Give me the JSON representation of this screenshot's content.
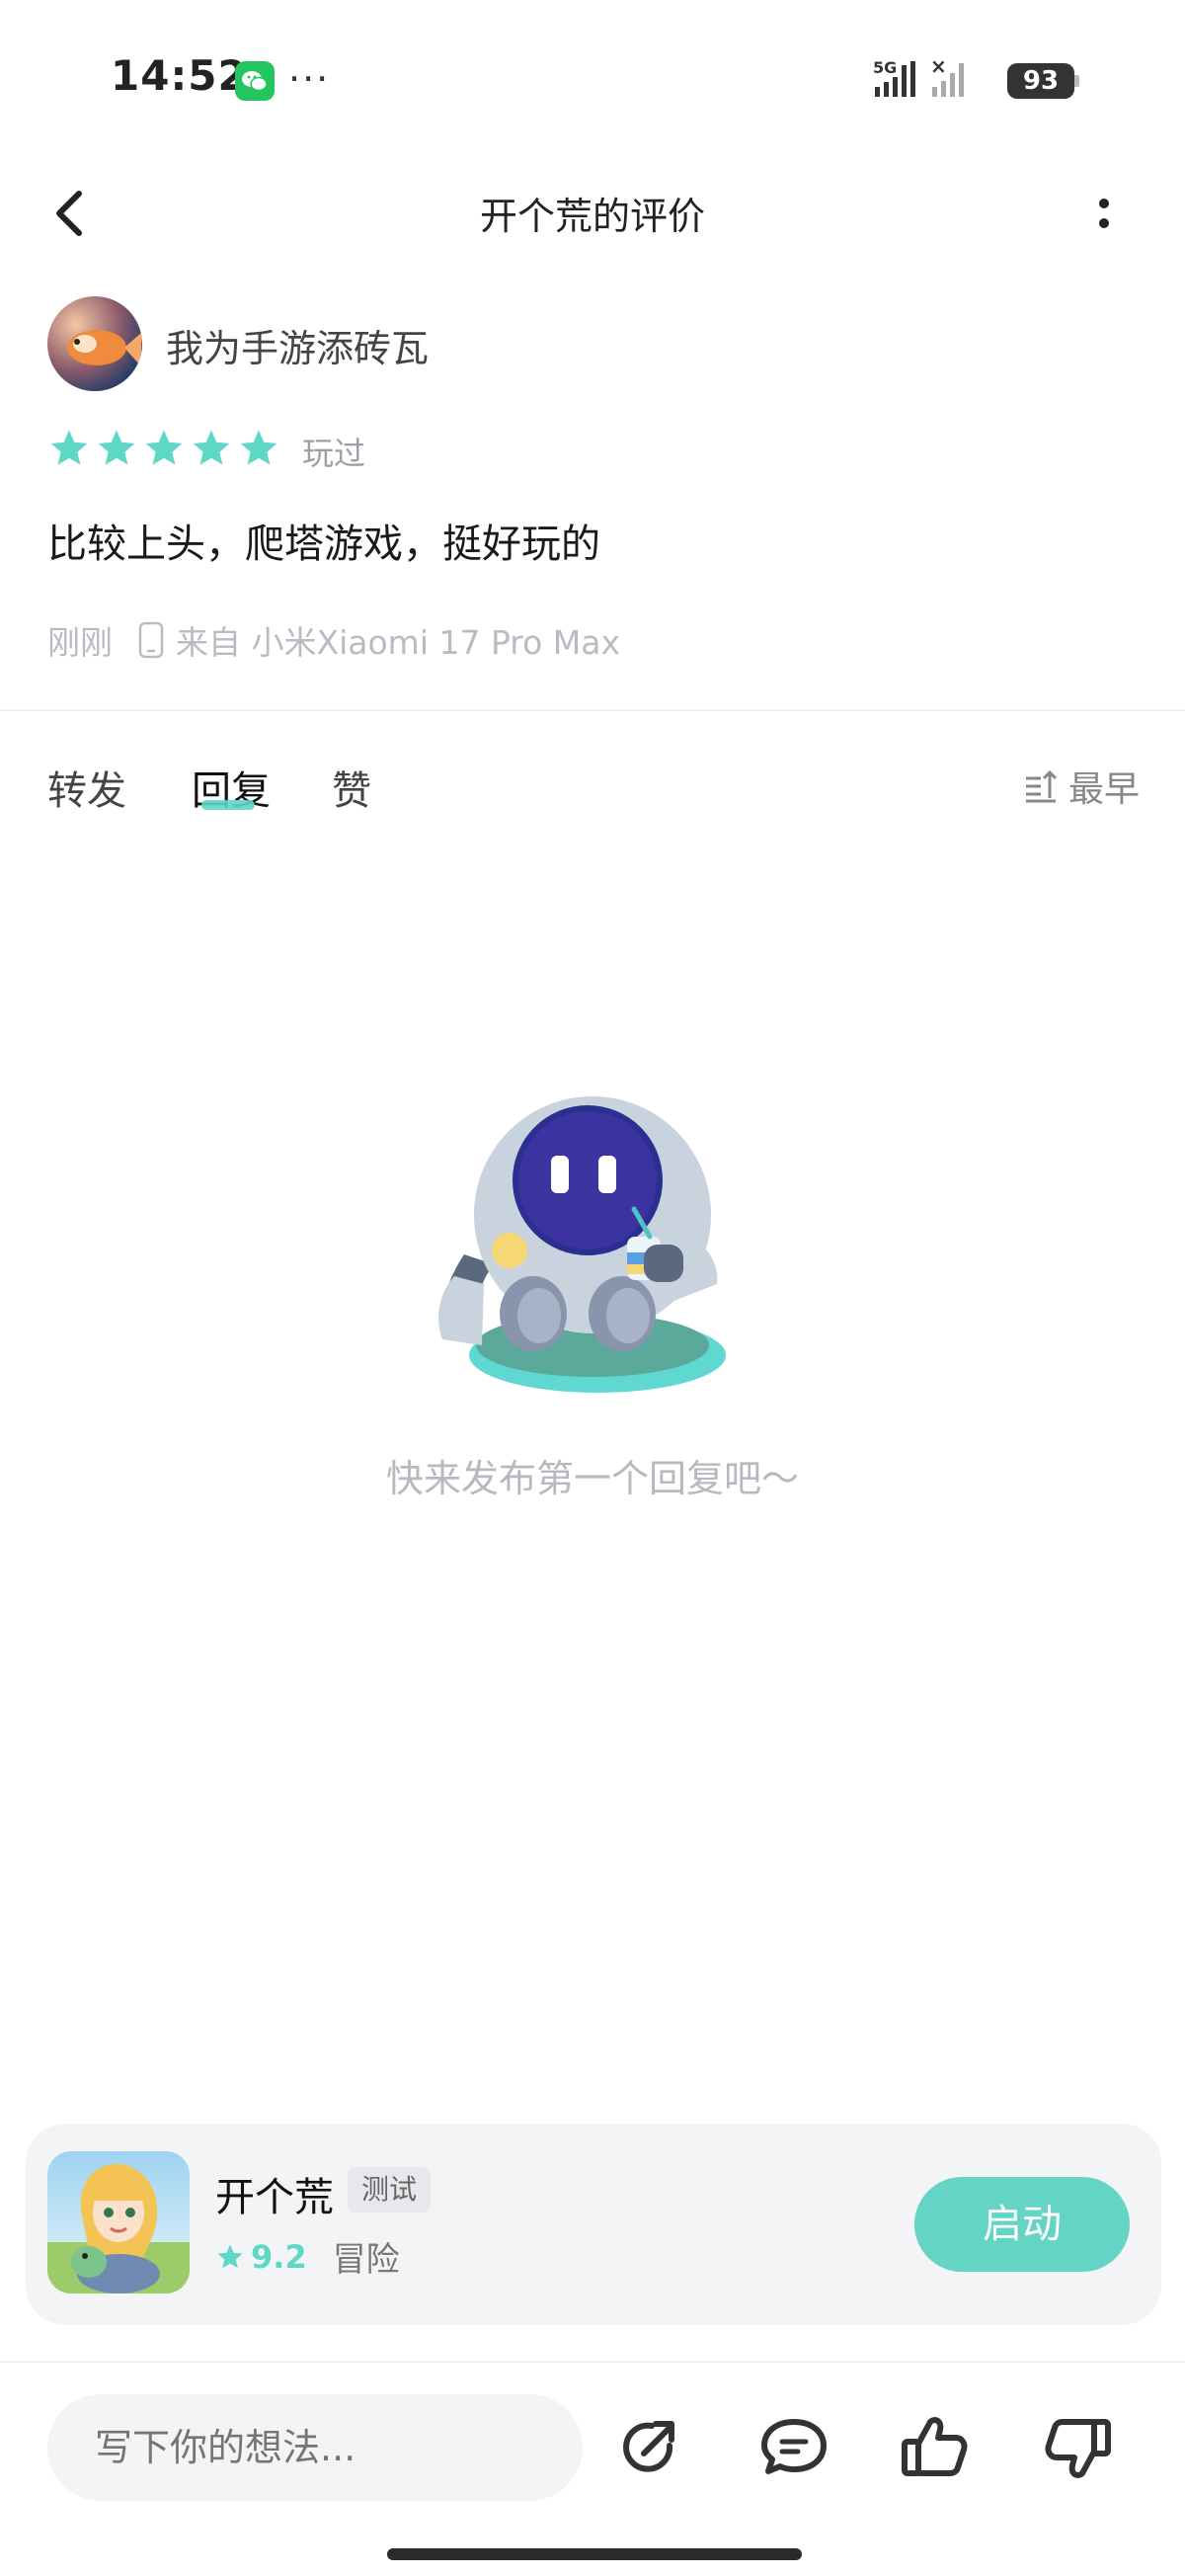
{
  "status_bar": {
    "time": "14:52",
    "dots": "···",
    "network": "5G",
    "battery": "93"
  },
  "nav": {
    "title": "开个荒的评价"
  },
  "review": {
    "username": "我为手游添砖瓦",
    "rating": 5,
    "played_tag": "玩过",
    "text": "比较上头，爬塔游戏，挺好玩的",
    "time": "刚刚",
    "device": "来自 小米Xiaomi 17 Pro Max"
  },
  "tabs": {
    "forward": "转发",
    "reply": "回复",
    "like": "赞",
    "sort": "最早"
  },
  "empty_state": {
    "text": "快来发布第一个回复吧～"
  },
  "game": {
    "name": "开个荒",
    "badge": "测试",
    "score": "9.2",
    "genre": "冒险",
    "launch_label": "启动"
  },
  "bottom_bar": {
    "placeholder": "写下你的想法..."
  },
  "colors": {
    "accent": "#64d5c4",
    "star": "#5fd7c6",
    "muted_text": "#b6bac0"
  }
}
